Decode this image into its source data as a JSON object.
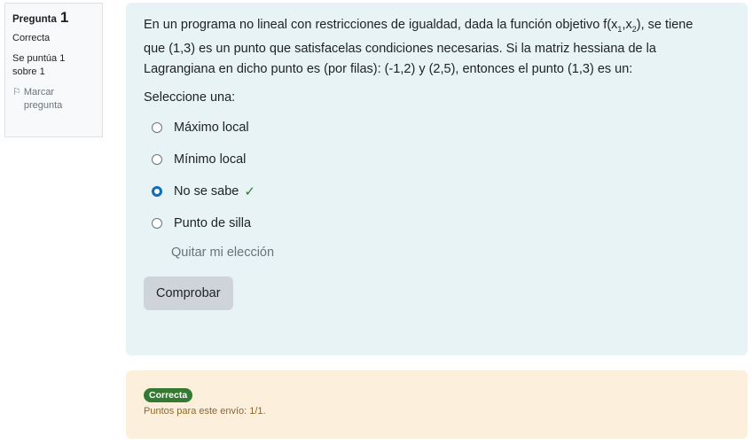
{
  "info": {
    "title_label": "Pregunta",
    "question_number": "1",
    "state": "Correcta",
    "grade": "Se puntúa 1 sobre 1",
    "flag_label": "Marcar pregunta"
  },
  "question": {
    "text_part1": "En un programa no lineal con restricciones de igualdad, dada la función objetivo f(x",
    "sub1": "1",
    "comma": ",x",
    "sub2": "2",
    "text_part2": "), se tiene que (1,3) es un punto que satisfacelas condiciones necesarias. Si la matriz hessiana de la Lagrangiana en dicho punto es (por filas): (-1,2) y (2,5), entonces el punto (1,3) es un:",
    "prompt": "Seleccione una:",
    "options": [
      {
        "label": "Máximo local",
        "selected": false
      },
      {
        "label": "Mínimo local",
        "selected": false
      },
      {
        "label": "No se sabe",
        "selected": true,
        "correct_icon": "check-icon"
      },
      {
        "label": "Punto de silla",
        "selected": false
      }
    ],
    "clear_label": "Quitar mi elección",
    "submit_label": "Comprobar"
  },
  "feedback": {
    "badge": "Correcta",
    "points": "Puntos para este envío: 1/1."
  },
  "colors": {
    "formulation_bg": "#e7f3f5",
    "feedback_bg": "#fcefdc",
    "correct_green": "#357a32",
    "radio_blue": "#0f6cbf"
  }
}
